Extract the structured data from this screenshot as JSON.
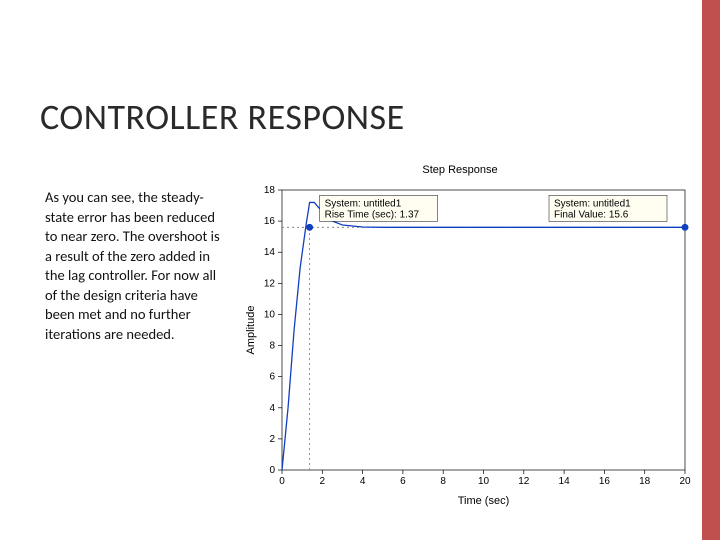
{
  "title": "CONTROLLER RESPONSE",
  "body_text": "As you can see, the steady-state error has been reduced to near zero. The overshoot is a result of the zero added in the lag controller. For now all of the design criteria have been met and no further iterations are needed.",
  "chart_data": {
    "type": "line",
    "title": "Step Response",
    "xlabel": "Time (sec)",
    "ylabel": "Amplitude",
    "xlim": [
      0,
      20
    ],
    "ylim": [
      0,
      18
    ],
    "xticks": [
      0,
      2,
      4,
      6,
      8,
      10,
      12,
      14,
      16,
      18,
      20
    ],
    "yticks": [
      0,
      2,
      4,
      6,
      8,
      10,
      12,
      14,
      16,
      18
    ],
    "series": [
      {
        "name": "untitled1",
        "x": [
          0,
          0.3,
          0.6,
          0.9,
          1.2,
          1.37,
          1.6,
          2.0,
          2.5,
          3.0,
          4.0,
          5.0,
          7.0,
          10.0,
          14.0,
          18.0,
          20.0
        ],
        "y": [
          0,
          4.0,
          9.0,
          13.0,
          15.8,
          17.2,
          17.2,
          16.6,
          16.0,
          15.75,
          15.62,
          15.6,
          15.6,
          15.6,
          15.6,
          15.6,
          15.6
        ]
      }
    ],
    "annotations": [
      {
        "lines": [
          "System: untitled1",
          "Rise Time (sec): 1.37"
        ],
        "marker_x": 1.37,
        "marker_y": 15.6,
        "box_rel": "right"
      },
      {
        "lines": [
          "System: untitled1",
          "Final Value: 15.6"
        ],
        "marker_x": 20.0,
        "marker_y": 15.6,
        "box_rel": "left"
      }
    ],
    "steady_state_line_y": 15.6,
    "rise_time_vline_x": 1.37
  }
}
